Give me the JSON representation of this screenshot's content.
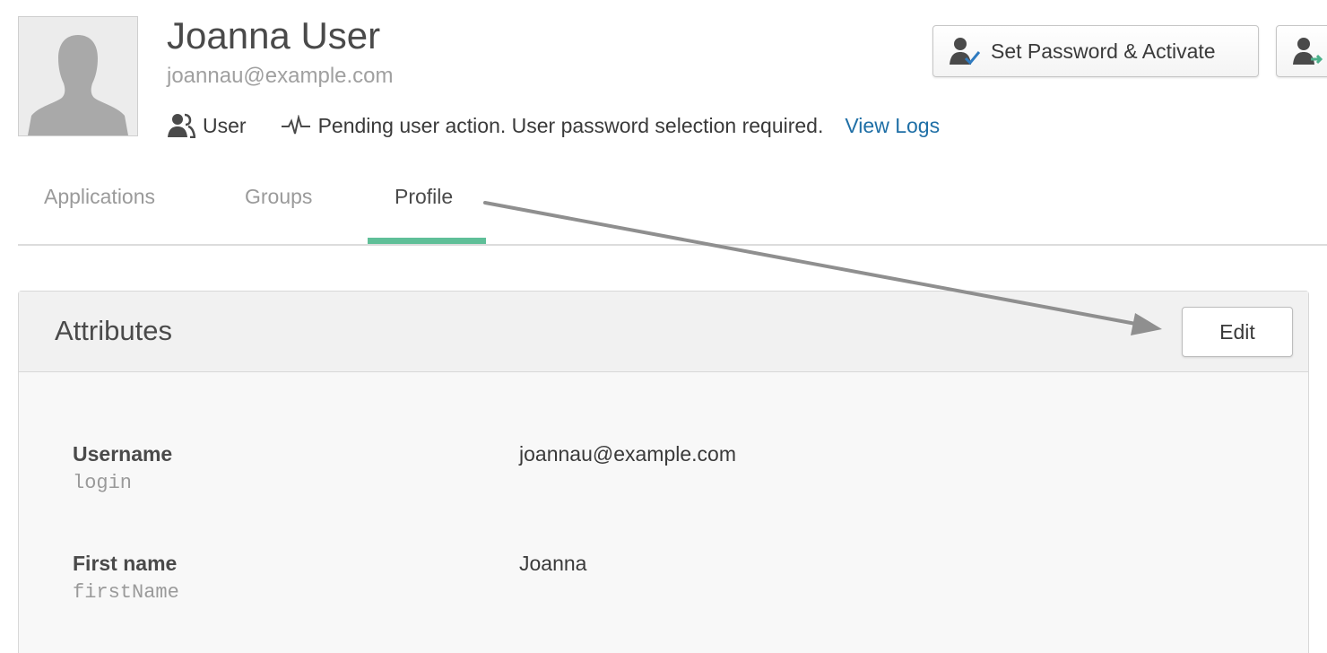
{
  "user": {
    "name": "Joanna User",
    "email": "joannau@example.com",
    "role": "User",
    "status": "Pending user action. User password selection required.",
    "view_logs": "View Logs"
  },
  "actions": {
    "set_password_activate": "Set Password & Activate"
  },
  "tabs": [
    {
      "label": "Applications",
      "active": false
    },
    {
      "label": "Groups",
      "active": false
    },
    {
      "label": "Profile",
      "active": true
    }
  ],
  "panel": {
    "title": "Attributes",
    "edit_label": "Edit",
    "attributes": [
      {
        "label": "Username",
        "key": "login",
        "value": "joannau@example.com"
      },
      {
        "label": "First name",
        "key": "firstName",
        "value": "Joanna"
      }
    ]
  },
  "colors": {
    "accent": "#5fbf98",
    "link": "#1f6fa6",
    "annotation_arrow": "#8f8f8f"
  }
}
